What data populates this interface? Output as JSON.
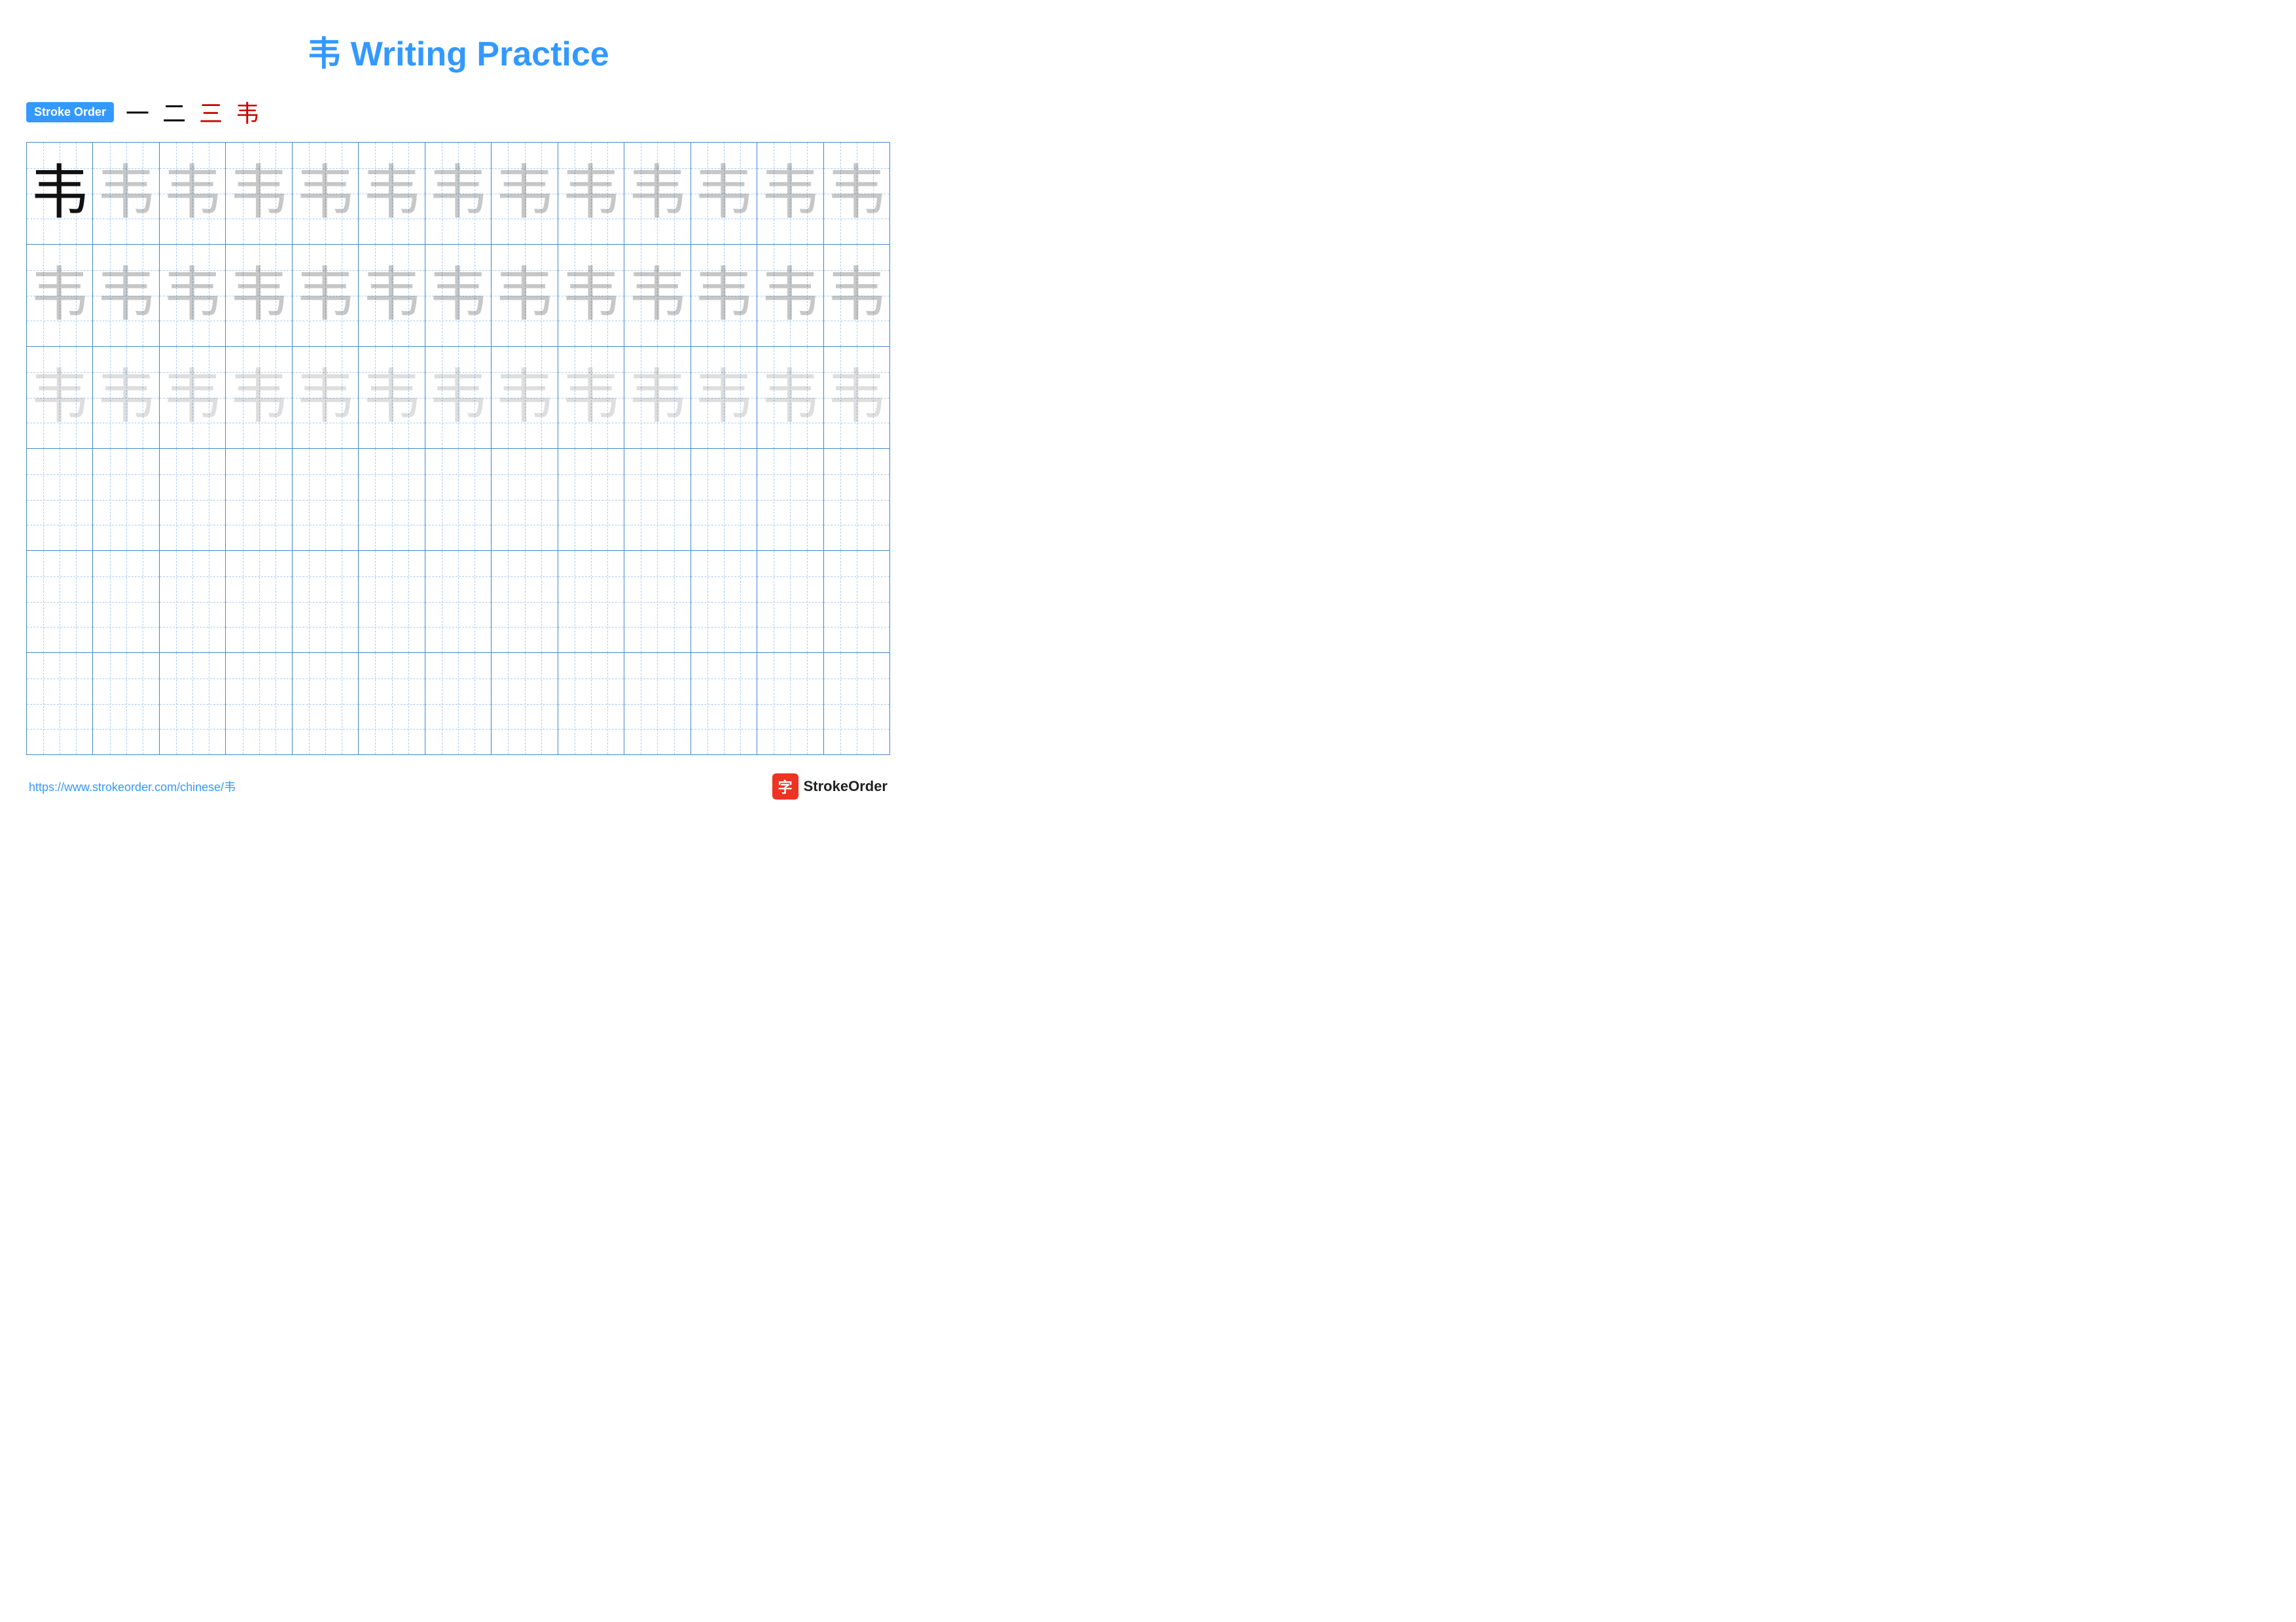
{
  "title": "韦 Writing Practice",
  "stroke_order_label": "Stroke Order",
  "stroke_steps": [
    "一",
    "二",
    "三",
    "韦"
  ],
  "character": "韦",
  "rows": [
    {
      "cells": [
        {
          "type": "solid"
        },
        {
          "type": "light1"
        },
        {
          "type": "light1"
        },
        {
          "type": "light1"
        },
        {
          "type": "light1"
        },
        {
          "type": "light1"
        },
        {
          "type": "light1"
        },
        {
          "type": "light1"
        },
        {
          "type": "light1"
        },
        {
          "type": "light1"
        },
        {
          "type": "light1"
        },
        {
          "type": "light1"
        },
        {
          "type": "light1"
        }
      ]
    },
    {
      "cells": [
        {
          "type": "light1"
        },
        {
          "type": "light1"
        },
        {
          "type": "light1"
        },
        {
          "type": "light1"
        },
        {
          "type": "light1"
        },
        {
          "type": "light1"
        },
        {
          "type": "light1"
        },
        {
          "type": "light1"
        },
        {
          "type": "light1"
        },
        {
          "type": "light1"
        },
        {
          "type": "light1"
        },
        {
          "type": "light1"
        },
        {
          "type": "light1"
        }
      ]
    },
    {
      "cells": [
        {
          "type": "light2"
        },
        {
          "type": "light2"
        },
        {
          "type": "light2"
        },
        {
          "type": "light2"
        },
        {
          "type": "light2"
        },
        {
          "type": "light2"
        },
        {
          "type": "light2"
        },
        {
          "type": "light2"
        },
        {
          "type": "light2"
        },
        {
          "type": "light2"
        },
        {
          "type": "light2"
        },
        {
          "type": "light2"
        },
        {
          "type": "light2"
        }
      ]
    },
    {
      "cells": [
        {
          "type": "empty"
        },
        {
          "type": "empty"
        },
        {
          "type": "empty"
        },
        {
          "type": "empty"
        },
        {
          "type": "empty"
        },
        {
          "type": "empty"
        },
        {
          "type": "empty"
        },
        {
          "type": "empty"
        },
        {
          "type": "empty"
        },
        {
          "type": "empty"
        },
        {
          "type": "empty"
        },
        {
          "type": "empty"
        },
        {
          "type": "empty"
        }
      ]
    },
    {
      "cells": [
        {
          "type": "empty"
        },
        {
          "type": "empty"
        },
        {
          "type": "empty"
        },
        {
          "type": "empty"
        },
        {
          "type": "empty"
        },
        {
          "type": "empty"
        },
        {
          "type": "empty"
        },
        {
          "type": "empty"
        },
        {
          "type": "empty"
        },
        {
          "type": "empty"
        },
        {
          "type": "empty"
        },
        {
          "type": "empty"
        },
        {
          "type": "empty"
        }
      ]
    },
    {
      "cells": [
        {
          "type": "empty"
        },
        {
          "type": "empty"
        },
        {
          "type": "empty"
        },
        {
          "type": "empty"
        },
        {
          "type": "empty"
        },
        {
          "type": "empty"
        },
        {
          "type": "empty"
        },
        {
          "type": "empty"
        },
        {
          "type": "empty"
        },
        {
          "type": "empty"
        },
        {
          "type": "empty"
        },
        {
          "type": "empty"
        },
        {
          "type": "empty"
        }
      ]
    }
  ],
  "footer": {
    "url": "https://www.strokeorder.com/chinese/韦",
    "brand_icon": "字",
    "brand_name": "StrokeOrder"
  }
}
